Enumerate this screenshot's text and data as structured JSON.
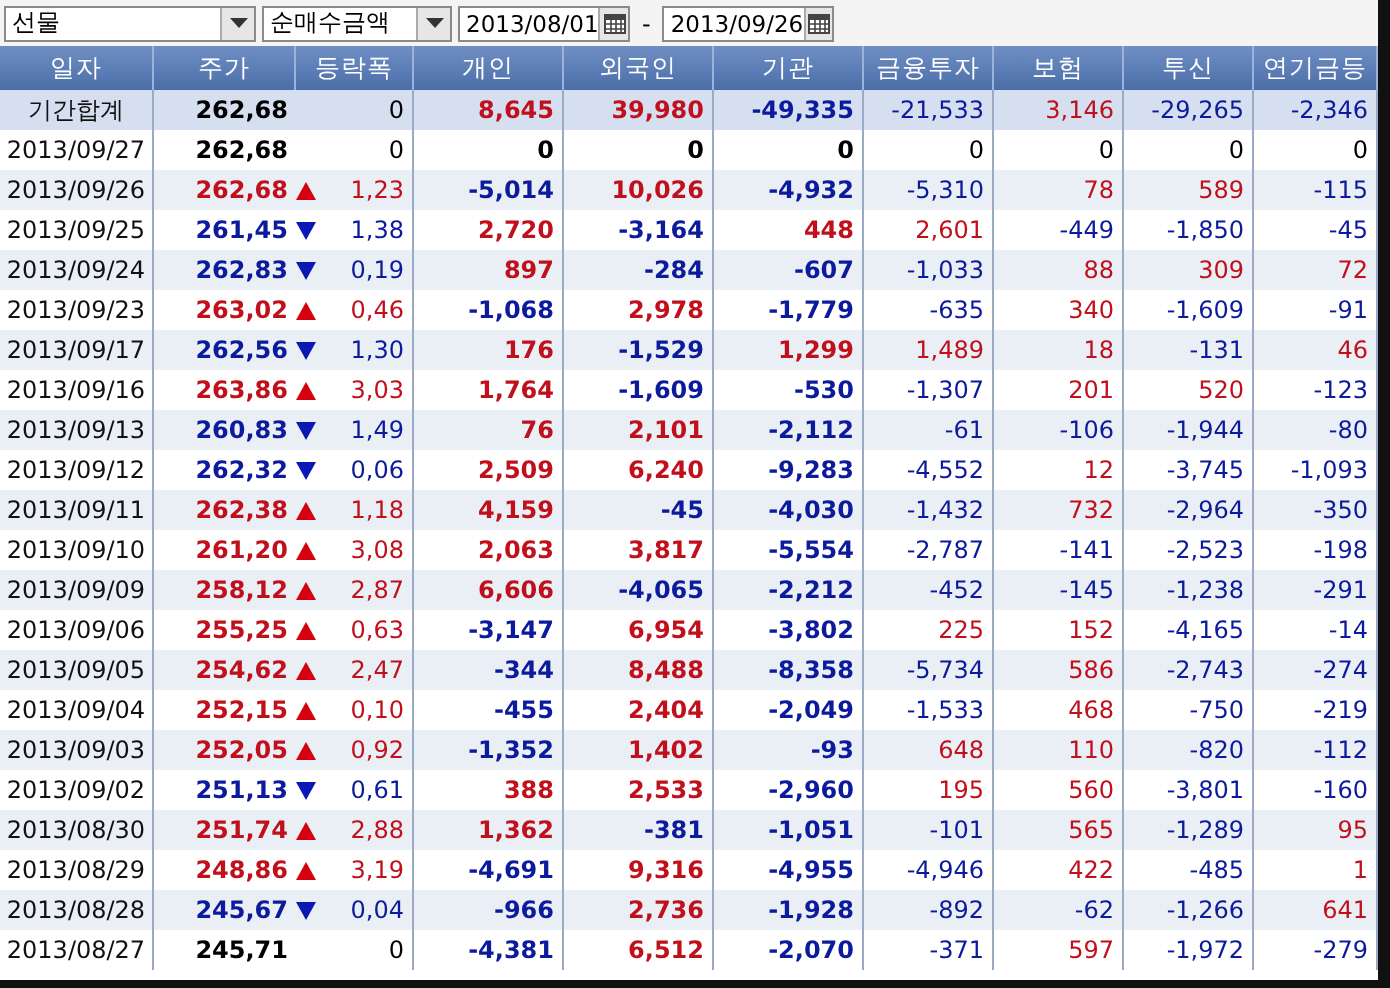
{
  "toolbar": {
    "market": "선물",
    "measure": "순매수금액",
    "date_from": "2013/08/01",
    "separator": "-",
    "date_to": "2013/09/26"
  },
  "columns": [
    "일자",
    "주가",
    "등락폭",
    "개인",
    "외국인",
    "기관",
    "금융투자",
    "보험",
    "투신",
    "연기금등"
  ],
  "total": {
    "date": "기간합계",
    "price": "262,68",
    "change": "0",
    "values": [
      "8,645",
      "39,980",
      "-49,335",
      "-21,533",
      "3,146",
      "-29,265",
      "-2,346"
    ]
  },
  "rows": [
    {
      "date": "2013/09/27",
      "price": "262,68",
      "up": false,
      "down": false,
      "change": "0",
      "values": [
        "0",
        "0",
        "0",
        "0",
        "0",
        "0",
        "0"
      ]
    },
    {
      "date": "2013/09/26",
      "price": "262,68",
      "up": true,
      "down": false,
      "change": "1,23",
      "values": [
        "-5,014",
        "10,026",
        "-4,932",
        "-5,310",
        "78",
        "589",
        "-115"
      ]
    },
    {
      "date": "2013/09/25",
      "price": "261,45",
      "up": false,
      "down": true,
      "change": "1,38",
      "values": [
        "2,720",
        "-3,164",
        "448",
        "2,601",
        "-449",
        "-1,850",
        "-45"
      ]
    },
    {
      "date": "2013/09/24",
      "price": "262,83",
      "up": false,
      "down": true,
      "change": "0,19",
      "values": [
        "897",
        "-284",
        "-607",
        "-1,033",
        "88",
        "309",
        "72"
      ]
    },
    {
      "date": "2013/09/23",
      "price": "263,02",
      "up": true,
      "down": false,
      "change": "0,46",
      "values": [
        "-1,068",
        "2,978",
        "-1,779",
        "-635",
        "340",
        "-1,609",
        "-91"
      ]
    },
    {
      "date": "2013/09/17",
      "price": "262,56",
      "up": false,
      "down": true,
      "change": "1,30",
      "values": [
        "176",
        "-1,529",
        "1,299",
        "1,489",
        "18",
        "-131",
        "46"
      ]
    },
    {
      "date": "2013/09/16",
      "price": "263,86",
      "up": true,
      "down": false,
      "change": "3,03",
      "values": [
        "1,764",
        "-1,609",
        "-530",
        "-1,307",
        "201",
        "520",
        "-123"
      ]
    },
    {
      "date": "2013/09/13",
      "price": "260,83",
      "up": false,
      "down": true,
      "change": "1,49",
      "values": [
        "76",
        "2,101",
        "-2,112",
        "-61",
        "-106",
        "-1,944",
        "-80"
      ]
    },
    {
      "date": "2013/09/12",
      "price": "262,32",
      "up": false,
      "down": true,
      "change": "0,06",
      "values": [
        "2,509",
        "6,240",
        "-9,283",
        "-4,552",
        "12",
        "-3,745",
        "-1,093"
      ]
    },
    {
      "date": "2013/09/11",
      "price": "262,38",
      "up": true,
      "down": false,
      "change": "1,18",
      "values": [
        "4,159",
        "-45",
        "-4,030",
        "-1,432",
        "732",
        "-2,964",
        "-350"
      ]
    },
    {
      "date": "2013/09/10",
      "price": "261,20",
      "up": true,
      "down": false,
      "change": "3,08",
      "values": [
        "2,063",
        "3,817",
        "-5,554",
        "-2,787",
        "-141",
        "-2,523",
        "-198"
      ]
    },
    {
      "date": "2013/09/09",
      "price": "258,12",
      "up": true,
      "down": false,
      "change": "2,87",
      "values": [
        "6,606",
        "-4,065",
        "-2,212",
        "-452",
        "-145",
        "-1,238",
        "-291"
      ]
    },
    {
      "date": "2013/09/06",
      "price": "255,25",
      "up": true,
      "down": false,
      "change": "0,63",
      "values": [
        "-3,147",
        "6,954",
        "-3,802",
        "225",
        "152",
        "-4,165",
        "-14"
      ]
    },
    {
      "date": "2013/09/05",
      "price": "254,62",
      "up": true,
      "down": false,
      "change": "2,47",
      "values": [
        "-344",
        "8,488",
        "-8,358",
        "-5,734",
        "586",
        "-2,743",
        "-274"
      ]
    },
    {
      "date": "2013/09/04",
      "price": "252,15",
      "up": true,
      "down": false,
      "change": "0,10",
      "values": [
        "-455",
        "2,404",
        "-2,049",
        "-1,533",
        "468",
        "-750",
        "-219"
      ]
    },
    {
      "date": "2013/09/03",
      "price": "252,05",
      "up": true,
      "down": false,
      "change": "0,92",
      "values": [
        "-1,352",
        "1,402",
        "-93",
        "648",
        "110",
        "-820",
        "-112"
      ]
    },
    {
      "date": "2013/09/02",
      "price": "251,13",
      "up": false,
      "down": true,
      "change": "0,61",
      "values": [
        "388",
        "2,533",
        "-2,960",
        "195",
        "560",
        "-3,801",
        "-160"
      ]
    },
    {
      "date": "2013/08/30",
      "price": "251,74",
      "up": true,
      "down": false,
      "change": "2,88",
      "values": [
        "1,362",
        "-381",
        "-1,051",
        "-101",
        "565",
        "-1,289",
        "95"
      ]
    },
    {
      "date": "2013/08/29",
      "price": "248,86",
      "up": true,
      "down": false,
      "change": "3,19",
      "values": [
        "-4,691",
        "9,316",
        "-4,955",
        "-4,946",
        "422",
        "-485",
        "1"
      ]
    },
    {
      "date": "2013/08/28",
      "price": "245,67",
      "up": false,
      "down": true,
      "change": "0,04",
      "values": [
        "-966",
        "2,736",
        "-1,928",
        "-892",
        "-62",
        "-1,266",
        "641"
      ]
    },
    {
      "date": "2013/08/27",
      "price": "245,71",
      "up": false,
      "down": false,
      "change": "0",
      "values": [
        "-4,381",
        "6,512",
        "-2,070",
        "-371",
        "597",
        "-1,972",
        "-279"
      ]
    }
  ]
}
